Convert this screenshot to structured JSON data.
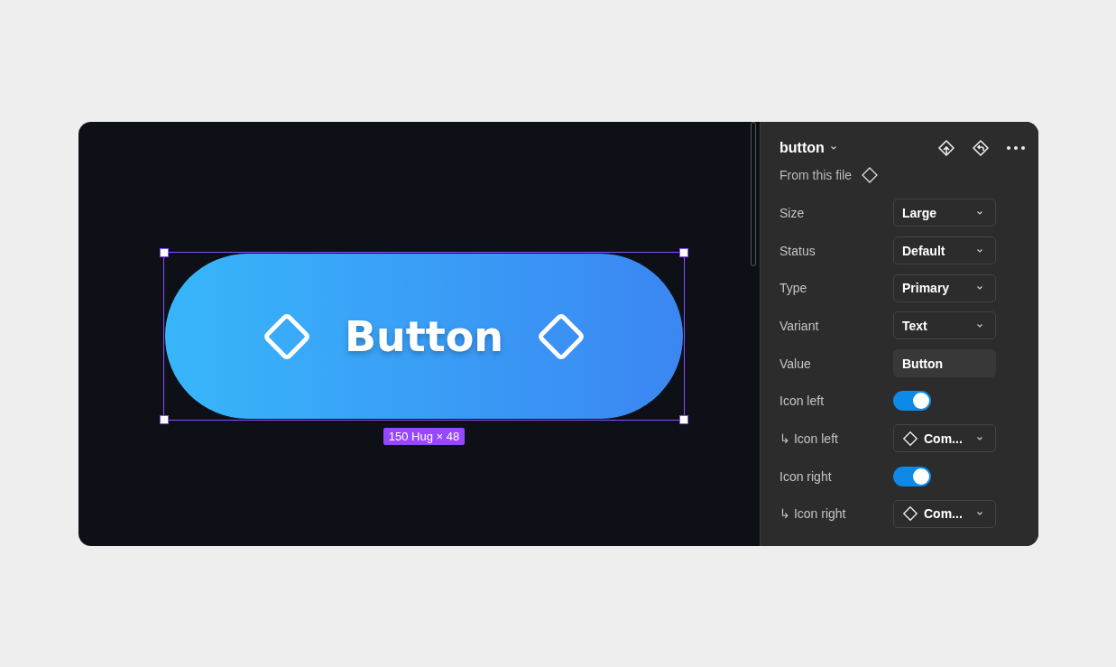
{
  "canvas": {
    "button": {
      "label": "Button",
      "icon_left": true,
      "icon_right": true,
      "selected": true
    },
    "size_label": "150 Hug × 48"
  },
  "panel": {
    "title": "button",
    "source": "From this file",
    "properties": [
      {
        "kind": "dropdown",
        "label": "Size",
        "value": "Large"
      },
      {
        "kind": "dropdown",
        "label": "Status",
        "value": "Default"
      },
      {
        "kind": "dropdown",
        "label": "Type",
        "value": "Primary"
      },
      {
        "kind": "dropdown",
        "label": "Variant",
        "value": "Text"
      },
      {
        "kind": "input",
        "label": "Value",
        "value": "Button"
      },
      {
        "kind": "toggle",
        "label": "Icon left",
        "on": true
      },
      {
        "kind": "instance",
        "label": "↳ Icon left",
        "value": "Com..."
      },
      {
        "kind": "toggle",
        "label": "Icon right",
        "on": true
      },
      {
        "kind": "instance",
        "label": "↳ Icon right",
        "value": "Com..."
      }
    ]
  }
}
